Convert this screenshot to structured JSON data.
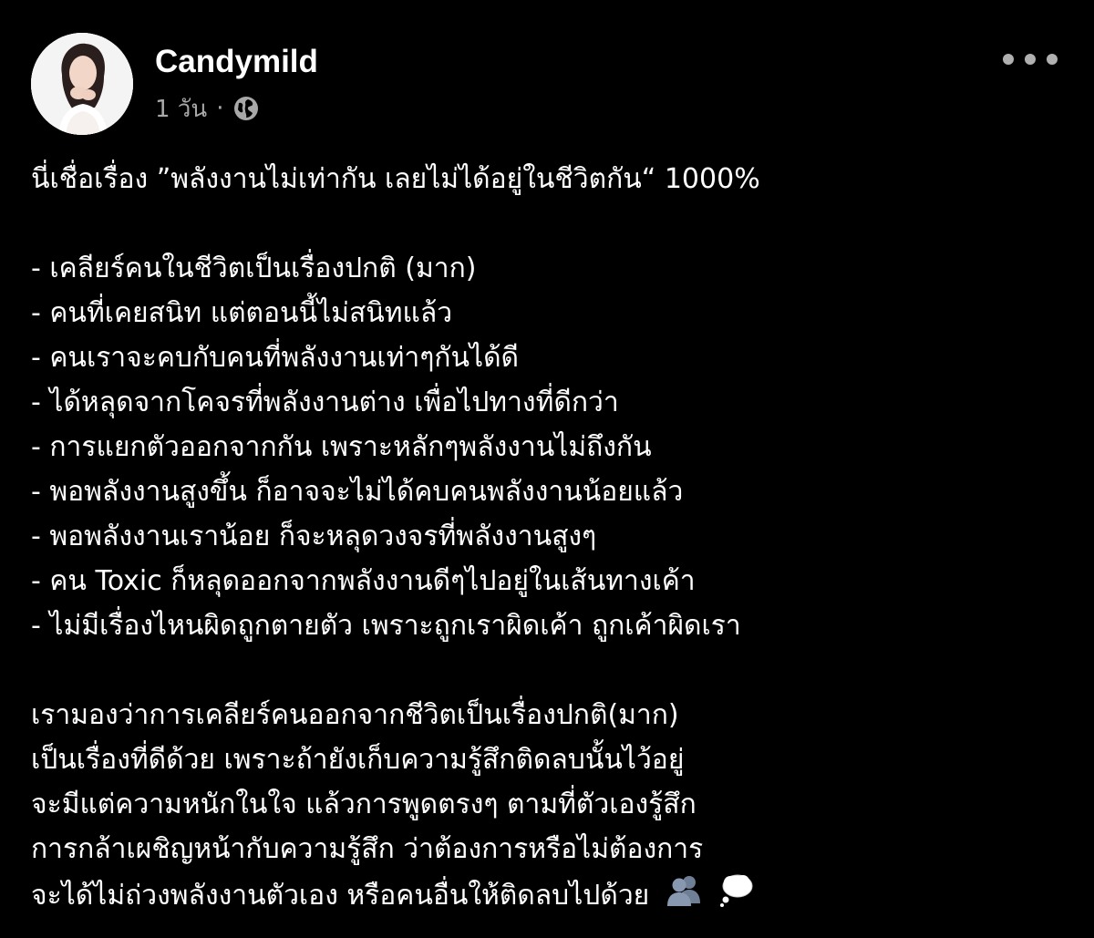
{
  "post": {
    "author": "Candymild",
    "time": "1 วัน",
    "separator": "·",
    "privacy_icon": "globe-icon",
    "more_icon": "more-horizontal-icon",
    "avatar": "profile-photo"
  },
  "content": {
    "intro": "นี่เชื่อเรื่อง ”พลังงานไม่เท่ากัน เลยไม่ได้อยู่ในชีวิตกัน“ 1000%",
    "bullets": [
      "- เคลียร์คนในชีวิตเป็นเรื่องปกติ (มาก)",
      "- คนที่เคยสนิท แต่ตอนนี้ไม่สนิทแล้ว",
      "- คนเราจะคบกับคนที่พลังงานเท่าๆกันได้ดี",
      "- ได้หลุดจากโคจรที่พลังงานต่าง เพื่อไปทางที่ดีกว่า",
      "- การแยกตัวออกจากกัน เพราะหลักๆพลังงานไม่ถึงกัน",
      "- พอพลังงานสูงขึ้น ก็อาจจะไม่ได้คบคนพลังงานน้อยแล้ว",
      "- พอพลังงานเราน้อย ก็จะหลุดวงจรที่พลังงานสูงๆ",
      "- คน Toxic ก็หลุดออกจากพลังงานดีๆไปอยู่ในเส้นทางเค้า",
      "- ไม่มีเรื่องไหนผิดถูกตายตัว เพราะถูกเราผิดเค้า ถูกเค้าผิดเรา"
    ],
    "closing": [
      "เรามองว่าการเคลียร์คนออกจากชีวิตเป็นเรื่องปกติ(มาก)",
      "เป็นเรื่องที่ดีด้วย เพราะถ้ายังเก็บความรู้สึกติดลบนั้นไว้อยู่",
      "จะมีแต่ความหนักในใจ แล้วการพูดตรงๆ ตามที่ตัวเองรู้สึก",
      "การกล้าเผชิญหน้ากับความรู้สึก ว่าต้องการหรือไม่ต้องการ",
      "จะได้ไม่ถ่วงพลังงานตัวเอง หรือคนอื่นให้ติดลบไปด้วย"
    ],
    "trailing_emojis": [
      "busts-in-silhouette-emoji",
      "thought-balloon-emoji"
    ]
  },
  "colors": {
    "background": "#000000",
    "text": "#ffffff",
    "secondary_text": "#a8a8a8"
  }
}
